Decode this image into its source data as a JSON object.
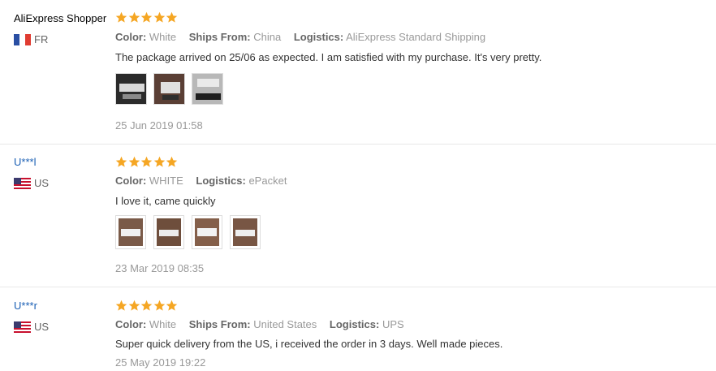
{
  "reviews": [
    {
      "user": "AliExpress Shopper",
      "country": "FR",
      "flag": "fr-flag-icon",
      "stars": 5,
      "meta": [
        {
          "key": "Color:",
          "value": "White"
        },
        {
          "key": "Ships From:",
          "value": "China"
        },
        {
          "key": "Logistics:",
          "value": "AliExpress Standard Shipping"
        }
      ],
      "text": "The package arrived on 25/06 as expected. I am satisfied with my purchase. It's very pretty.",
      "photos": 3,
      "date": "25 Jun 2019 01:58"
    },
    {
      "user": "U***l",
      "country": "US",
      "flag": "us-flag-icon",
      "stars": 5,
      "meta": [
        {
          "key": "Color:",
          "value": "WHITE"
        },
        {
          "key": "Logistics:",
          "value": "ePacket"
        }
      ],
      "text": "I love it, came quickly",
      "photos": 4,
      "date": "23 Mar 2019 08:35"
    },
    {
      "user": "U***r",
      "country": "US",
      "flag": "us-flag-icon",
      "stars": 5,
      "meta": [
        {
          "key": "Color:",
          "value": "White"
        },
        {
          "key": "Ships From:",
          "value": "United States"
        },
        {
          "key": "Logistics:",
          "value": "UPS"
        }
      ],
      "text": "Super quick delivery from the US, i received the order in 3 days. Well made pieces.",
      "photos": 0,
      "date": "25 May 2019 19:22"
    }
  ],
  "colors": {
    "star": "#f5a623",
    "link": "#1a5fb4"
  }
}
